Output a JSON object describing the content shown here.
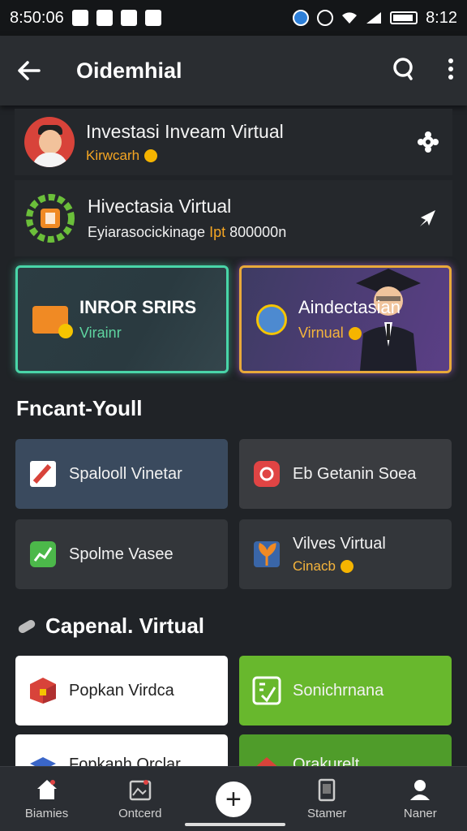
{
  "status_bar": {
    "left_time": "8:50:06",
    "right_time": "8:12"
  },
  "app_bar": {
    "title": "Oidemhial"
  },
  "list": [
    {
      "title": "Investasi Inveam Virtual",
      "subtitle": "Kirwcarh"
    },
    {
      "title": "Hivectasia Virtual",
      "subtitle_main": "Eyiarasocickinage",
      "subtitle_highlight": "Ipt",
      "subtitle_value": "800000n"
    }
  ],
  "promo": {
    "left": {
      "title": "INROR SRIRS",
      "subtitle": "Virainr"
    },
    "right": {
      "title": "Aindectasian",
      "subtitle": "Virnual"
    }
  },
  "section1": {
    "title": "Fncant-Youll",
    "tiles": [
      {
        "label": "Spalooll Vinetar"
      },
      {
        "label": "Eb Getanin Soea"
      },
      {
        "label": "Spolme Vasee"
      },
      {
        "label": "Vilves Virtual",
        "sub": "Cinacb"
      }
    ]
  },
  "section2": {
    "title": "Capenal. Virtual",
    "tiles": [
      {
        "label": "Popkan Virdca"
      },
      {
        "label": "Sonichrnana"
      },
      {
        "label": "Fopkanh Orclar"
      },
      {
        "label": "Orakurelt"
      }
    ]
  },
  "bottom_nav": [
    {
      "label": "Biamies"
    },
    {
      "label": "Ontcerd"
    },
    {
      "label": ""
    },
    {
      "label": "Stamer"
    },
    {
      "label": "Naner"
    }
  ],
  "colors": {
    "green_accent": "#49d5a8",
    "gold_accent": "#f5a623",
    "purple_card": "#5b3f86",
    "green_tile": "#68b82d"
  }
}
